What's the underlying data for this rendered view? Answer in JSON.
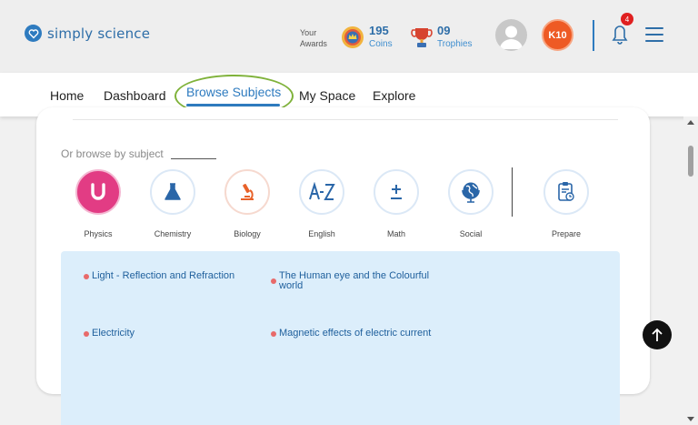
{
  "brand": {
    "name": "simply science"
  },
  "header": {
    "awards_label": "Your Awards",
    "coins": {
      "value": "195",
      "label": "Coins"
    },
    "trophies": {
      "value": "09",
      "label": "Trophies"
    },
    "grade_badge": "K10",
    "notification_count": "4"
  },
  "nav": {
    "items": [
      "Home",
      "Dashboard",
      "Browse Subjects",
      "My Space",
      "Explore"
    ],
    "active": "Browse Subjects"
  },
  "browse": {
    "label": "Or browse by subject",
    "subjects": [
      "Physics",
      "Chemistry",
      "Biology",
      "English",
      "Math",
      "Social"
    ],
    "active_subject": "Physics",
    "prepare_label": "Prepare"
  },
  "chapters": [
    "Light - Reflection and Refraction",
    "The Human eye and the Colourful world",
    "Electricity",
    "Magnetic effects of electric current"
  ],
  "colors": {
    "brand_blue": "#2e7bbf",
    "physics_pink": "#e23c84",
    "grade_orange": "#ee5a24",
    "highlight_green": "#7fb23a",
    "chapter_panel": "#dceefb"
  }
}
